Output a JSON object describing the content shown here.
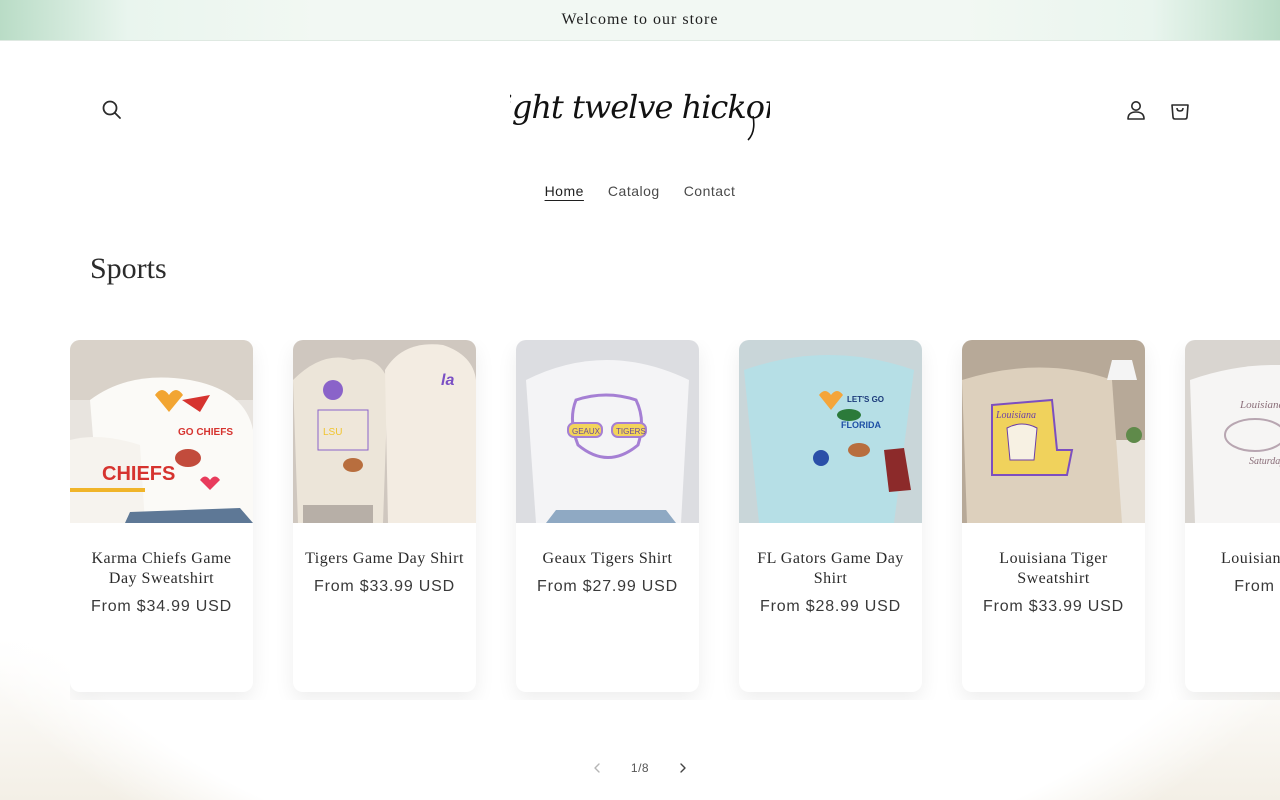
{
  "announcement": "Welcome to our store",
  "header": {
    "logo_text": "eight twelve hickory",
    "icons": [
      "search-icon",
      "account-icon",
      "cart-icon"
    ]
  },
  "nav": [
    {
      "label": "Home",
      "active": true
    },
    {
      "label": "Catalog",
      "active": false
    },
    {
      "label": "Contact",
      "active": false
    }
  ],
  "section": {
    "title": "Sports"
  },
  "products": [
    {
      "title": "Karma Chiefs Game Day Sweatshirt",
      "price": "From $34.99 USD"
    },
    {
      "title": "Tigers Game Day Shirt",
      "price": "From $33.99 USD"
    },
    {
      "title": "Geaux Tigers Shirt",
      "price": "From $27.99 USD"
    },
    {
      "title": "FL Gators Game Day Shirt",
      "price": "From $28.99 USD"
    },
    {
      "title": "Louisiana Tiger Sweatshirt",
      "price": "From $33.99 USD"
    },
    {
      "title": "Louisiana Night",
      "price": "From $ US"
    }
  ],
  "pagination": {
    "counter": "1/8"
  },
  "colors": {
    "announcement_bg": "#f2f8f3",
    "accent_green": "#b9dcc6"
  }
}
